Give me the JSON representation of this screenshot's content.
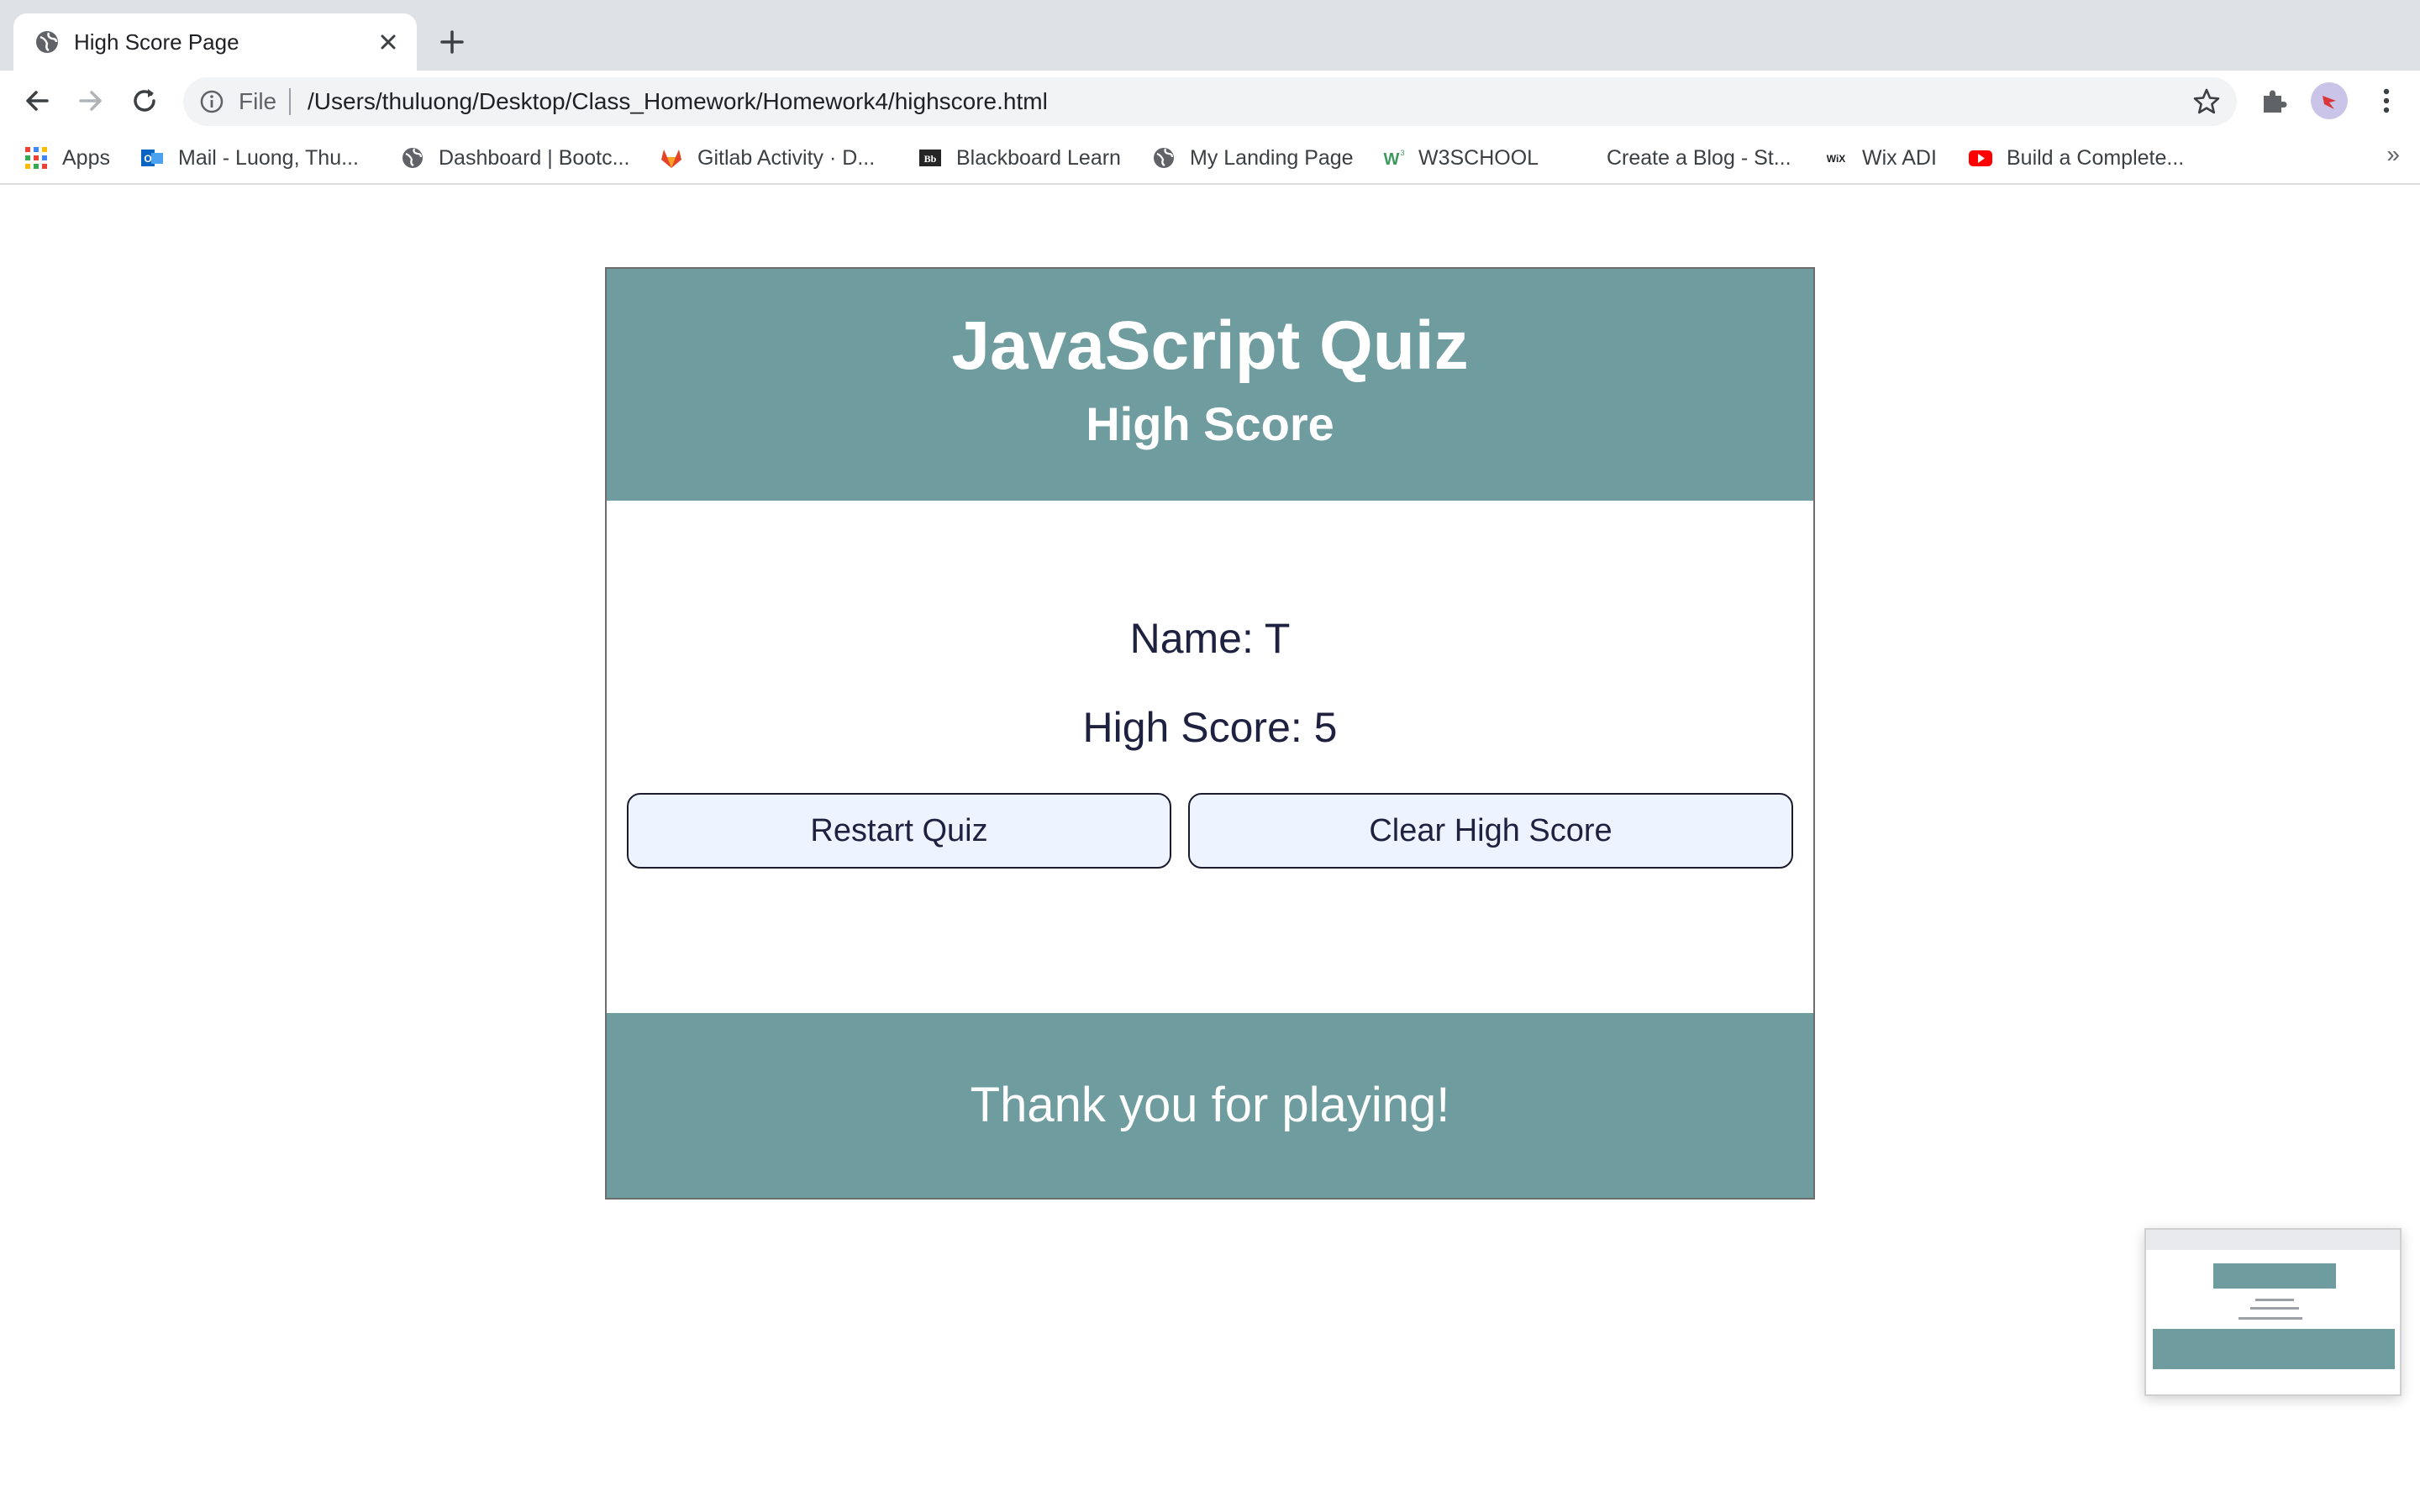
{
  "browser": {
    "tab_title": "High Score Page",
    "omnibox_scheme": "File",
    "url": "/Users/thuluong/Desktop/Class_Homework/Homework4/highscore.html"
  },
  "bookmarks": [
    {
      "label": "Apps",
      "icon": "apps-grid-icon"
    },
    {
      "label": "Mail - Luong, Thu...",
      "icon": "outlook-icon"
    },
    {
      "label": "Dashboard | Bootc...",
      "icon": "globe-icon"
    },
    {
      "label": "Gitlab Activity · D...",
      "icon": "gitlab-icon"
    },
    {
      "label": "Blackboard Learn",
      "icon": "blackboard-icon"
    },
    {
      "label": "My Landing Page",
      "icon": "globe-icon"
    },
    {
      "label": "W3SCHOOL",
      "icon": "w3schools-icon"
    },
    {
      "label": "Create a Blog - St...",
      "icon": "blank-icon"
    },
    {
      "label": "Wix ADI",
      "icon": "wix-icon"
    },
    {
      "label": "Build a Complete...",
      "icon": "youtube-icon"
    }
  ],
  "bookmarks_more": "»",
  "page": {
    "title": "JavaScript Quiz",
    "subtitle": "High Score",
    "name_line": "Name: T",
    "score_line": "High Score: 5",
    "restart_button": "Restart Quiz",
    "clear_button": "Clear High Score",
    "footer_text": "Thank you for playing!"
  },
  "colors": {
    "header_bg": "#6f9c9e",
    "button_bg": "#eef4ff",
    "body_text": "#1e2140"
  }
}
